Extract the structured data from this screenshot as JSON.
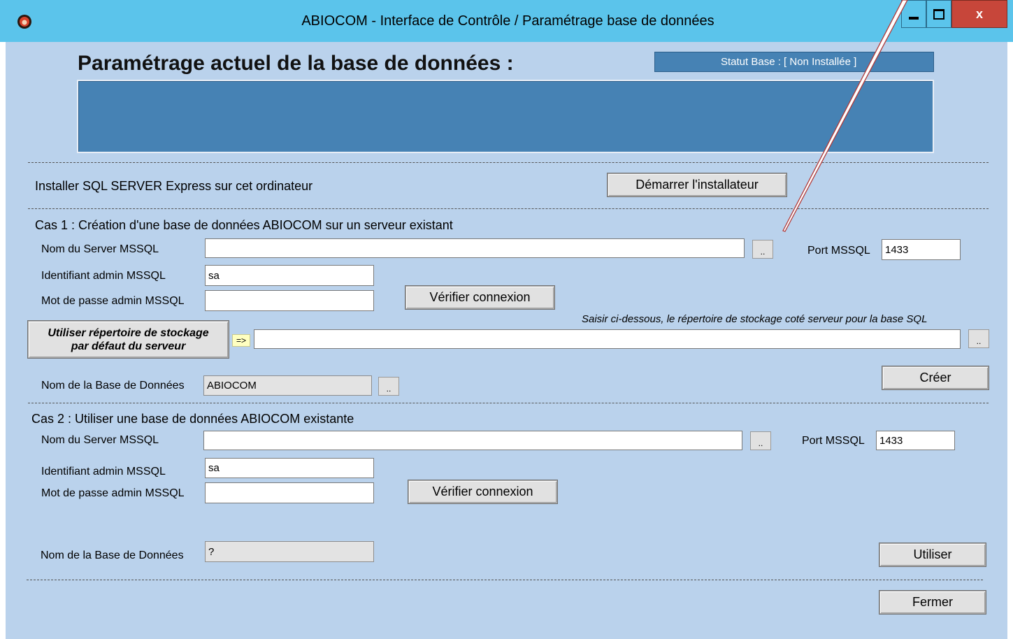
{
  "window": {
    "title": "ABIOCOM - Interface de Contrôle / Paramétrage base de données",
    "controls": {
      "minimize": "▬",
      "maximize": "☐",
      "close": "x"
    }
  },
  "header": {
    "heading": "Paramétrage actuel de la base de données :",
    "status": "Statut Base : [ Non Installée ]"
  },
  "install": {
    "label": "Installer SQL SERVER Express sur cet ordinateur",
    "button": "Démarrer l'installateur"
  },
  "cas1": {
    "title": "Cas 1 : Création d'une base de données ABIOCOM sur un serveur existant",
    "server_label": "Nom du Server MSSQL",
    "server_value": "",
    "browse": "..",
    "port_label": "Port MSSQL",
    "port_value": "1433",
    "user_label": "Identifiant admin MSSQL",
    "user_value": "sa",
    "password_label": "Mot de passe admin MSSQL",
    "password_value": "",
    "verify_button": "Vérifier connexion",
    "storage_hint": "Saisir ci-dessous, le répertoire de stockage coté serveur pour la base SQL",
    "default_storage_button_line1": "Utiliser répertoire de stockage",
    "default_storage_button_line2": "par défaut du serveur",
    "arrow": "=>",
    "storage_value": "",
    "storage_browse": "..",
    "dbname_label": "Nom de la Base de Données",
    "dbname_value": "ABIOCOM",
    "dbname_browse": "..",
    "create_button": "Créer"
  },
  "cas2": {
    "title": "Cas 2 : Utiliser une base de données ABIOCOM existante",
    "server_label": "Nom du Server MSSQL",
    "server_value": "",
    "browse": "..",
    "port_label": "Port MSSQL",
    "port_value": "1433",
    "user_label": "Identifiant admin MSSQL",
    "user_value": "sa",
    "password_label": "Mot de passe admin MSSQL",
    "password_value": "",
    "verify_button": "Vérifier connexion",
    "dbname_label": "Nom de la Base de Données",
    "dbname_value": "?",
    "use_button": "Utiliser"
  },
  "footer": {
    "close_button": "Fermer"
  },
  "colors": {
    "titlebar": "#5bc4eb",
    "client": "#bad2ec",
    "panel": "#4682b4",
    "annotation_arrow": "#b03a3a",
    "close_button": "#c7463a"
  }
}
